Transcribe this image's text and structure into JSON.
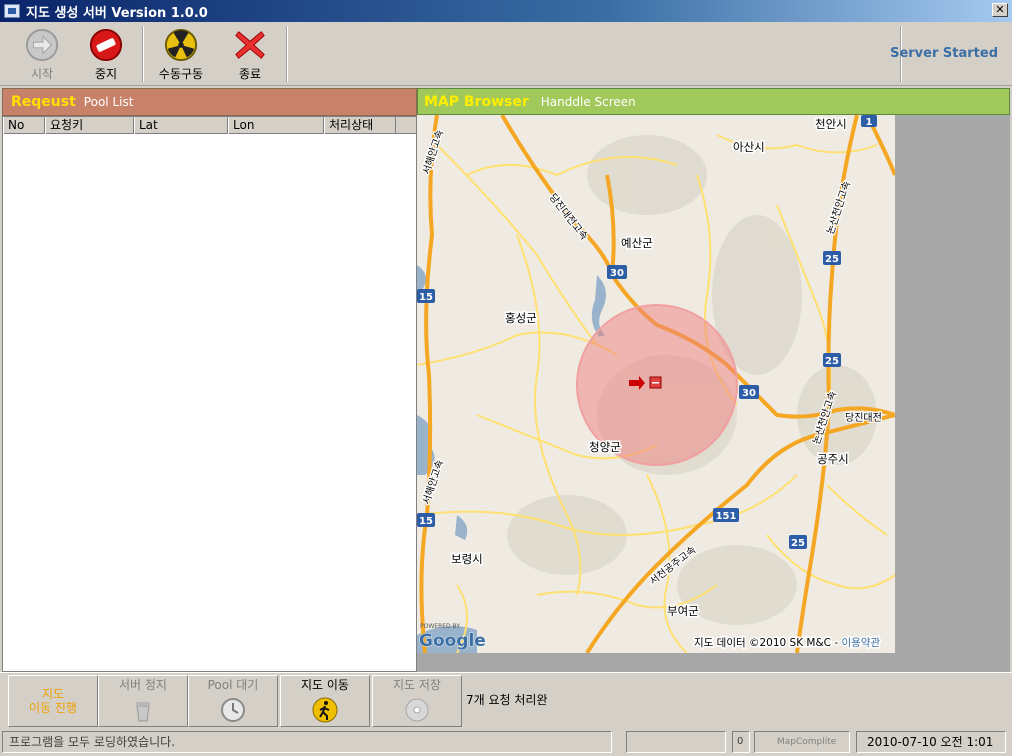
{
  "window": {
    "title": "지도 생성 서버 Version 1.0.0",
    "close_glyph": "✕"
  },
  "toolbar": {
    "buttons": [
      {
        "label": "시작",
        "icon": "start-arrow-icon",
        "enabled": false
      },
      {
        "label": "중지",
        "icon": "stop-icon",
        "enabled": true
      },
      {
        "label": "수동구동",
        "icon": "radiation-icon",
        "enabled": true
      },
      {
        "label": "종료",
        "icon": "exit-x-icon",
        "enabled": true
      }
    ],
    "status": "Server Started"
  },
  "request_panel": {
    "title": "Reqeust",
    "subtitle": "Pool List",
    "header_color": "#c9826a",
    "columns": [
      "No",
      "요청키",
      "Lat",
      "Lon",
      "처리상태"
    ]
  },
  "map_panel": {
    "title": "MAP Browser",
    "subtitle": "Handdle Screen",
    "header_color": "#a0c85a",
    "labels": {
      "cheonan": "천안시",
      "asan": "아산시",
      "yesan": "예산군",
      "hongseong": "홍성군",
      "cheongyang": "청양군",
      "gongju": "공주시",
      "boryeong": "보령시",
      "buyeo": "부여군"
    },
    "road_labels": {
      "dangjin_daejeon": "당진대전고속",
      "dangjin_daejeon_2": "당진대전",
      "seohaean": "서해안고속",
      "seohaean_2": "서해안고속",
      "nonsan_cheonan": "논산천안고속",
      "nonsan_cheonan_2": "논산천안고속",
      "seocheon_gongju": "서천공주고속"
    },
    "shields": [
      "1",
      "15",
      "30",
      "25",
      "25",
      "30",
      "15",
      "151",
      "25"
    ],
    "attribution": "지도 데이터 ©2010 SK M&C - ",
    "terms_link": "이용약관",
    "powered_by": "POWERED BY",
    "google": "Google"
  },
  "bottom_buttons": [
    {
      "label": "지도\n이동 진행",
      "icon": "",
      "state": "alert"
    },
    {
      "label": "서버 정지",
      "icon": "trash-icon",
      "state": "disabled"
    },
    {
      "label": "Pool 대기",
      "icon": "clock-icon",
      "state": "disabled"
    },
    {
      "label": "지도 이동",
      "icon": "walking-icon",
      "state": "active"
    },
    {
      "label": "지도 저장",
      "icon": "disc-icon",
      "state": "disabled"
    }
  ],
  "bottom_status": "7개 요청 처리완",
  "statusbar": {
    "message": "프로그램을 모두 로딩하였습니다.",
    "counter": "0",
    "map_state": "MapComplite",
    "datetime": "2010-07-10 오전 1:01"
  }
}
